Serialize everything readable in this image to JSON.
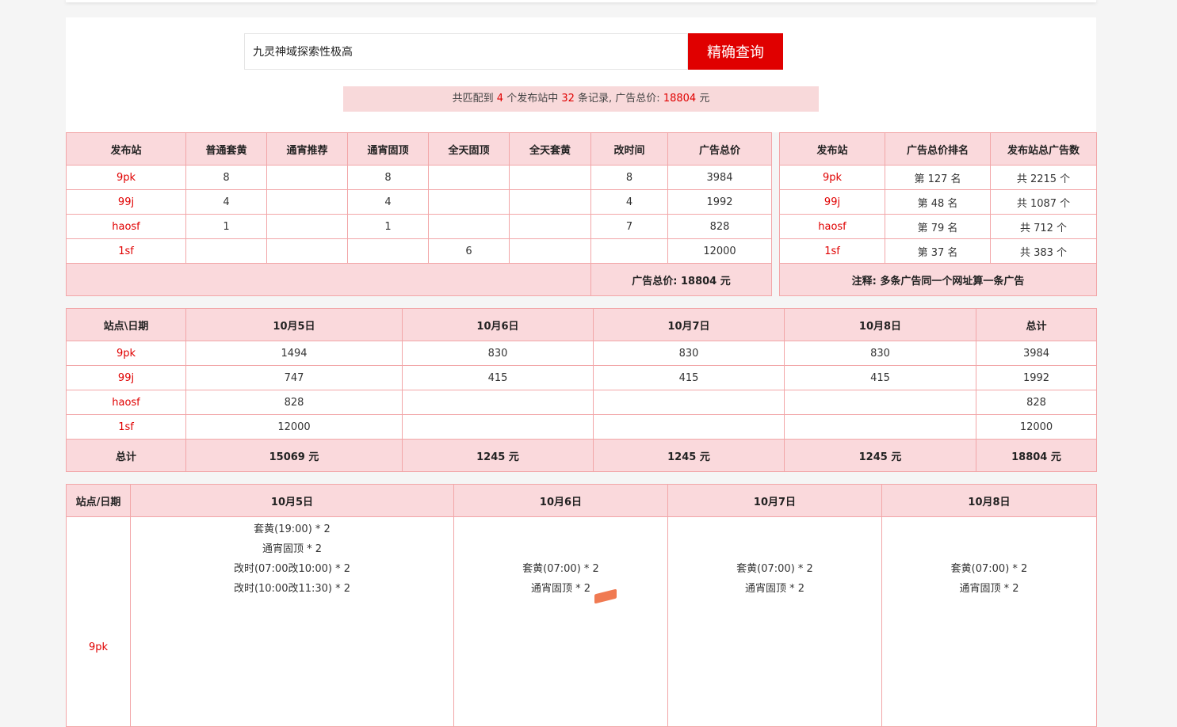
{
  "search": {
    "query": "九灵神域探索性极高",
    "button_label": "精确查询"
  },
  "summary": {
    "prefix": "共匹配到",
    "site_count": "4",
    "mid1": "个发布站中",
    "record_count": "32",
    "mid2": "条记录, 广告总价:",
    "total": "18804",
    "suffix": "元"
  },
  "table1": {
    "headers": [
      "发布站",
      "普通套黄",
      "通宵推荐",
      "通宵固顶",
      "全天固顶",
      "全天套黄",
      "改时间",
      "广告总价"
    ],
    "rows": [
      {
        "site": "9pk",
        "c1": "8",
        "c2": "",
        "c3": "8",
        "c4": "",
        "c5": "",
        "c6": "8",
        "c7": "3984"
      },
      {
        "site": "99j",
        "c1": "4",
        "c2": "",
        "c3": "4",
        "c4": "",
        "c5": "",
        "c6": "4",
        "c7": "1992"
      },
      {
        "site": "haosf",
        "c1": "1",
        "c2": "",
        "c3": "1",
        "c4": "",
        "c5": "",
        "c6": "7",
        "c7": "828"
      },
      {
        "site": "1sf",
        "c1": "",
        "c2": "",
        "c3": "",
        "c4": "6",
        "c5": "",
        "c6": "",
        "c7": "12000"
      }
    ],
    "footer": "广告总价: 18804 元"
  },
  "table2": {
    "headers": [
      "发布站",
      "广告总价排名",
      "发布站总广告数"
    ],
    "rows": [
      {
        "site": "9pk",
        "rank": "第 127 名",
        "count": "共 2215 个"
      },
      {
        "site": "99j",
        "rank": "第 48 名",
        "count": "共 1087 个"
      },
      {
        "site": "haosf",
        "rank": "第 79 名",
        "count": "共 712 个"
      },
      {
        "site": "1sf",
        "rank": "第 37 名",
        "count": "共 383 个"
      }
    ],
    "footer": "注释: 多条广告同一个网址算一条广告"
  },
  "table3": {
    "headers": [
      "站点\\日期",
      "10月5日",
      "10月6日",
      "10月7日",
      "10月8日",
      "总计"
    ],
    "rows": [
      {
        "site": "9pk",
        "d1": "1494",
        "d2": "830",
        "d3": "830",
        "d4": "830",
        "total": "3984"
      },
      {
        "site": "99j",
        "d1": "747",
        "d2": "415",
        "d3": "415",
        "d4": "415",
        "total": "1992"
      },
      {
        "site": "haosf",
        "d1": "828",
        "d2": "",
        "d3": "",
        "d4": "",
        "total": "828"
      },
      {
        "site": "1sf",
        "d1": "12000",
        "d2": "",
        "d3": "",
        "d4": "",
        "total": "12000"
      }
    ],
    "footer": {
      "label": "总计",
      "d1": "15069 元",
      "d2": "1245 元",
      "d3": "1245 元",
      "d4": "1245 元",
      "total": "18804 元"
    }
  },
  "table4": {
    "headers": [
      "站点/日期",
      "10月5日",
      "10月6日",
      "10月7日",
      "10月8日"
    ],
    "rows": [
      {
        "site": "9pk",
        "d1": [
          "套黄(19:00) * 2",
          "通宵固顶 * 2",
          "改时(07:00改10:00) * 2",
          "改时(10:00改11:30) * 2"
        ],
        "d2": [
          "套黄(07:00) * 2",
          "通宵固顶 * 2"
        ],
        "d3": [
          "套黄(07:00) * 2",
          "通宵固顶 * 2"
        ],
        "d4": [
          "套黄(07:00) * 2",
          "通宵固顶 * 2"
        ]
      }
    ]
  }
}
